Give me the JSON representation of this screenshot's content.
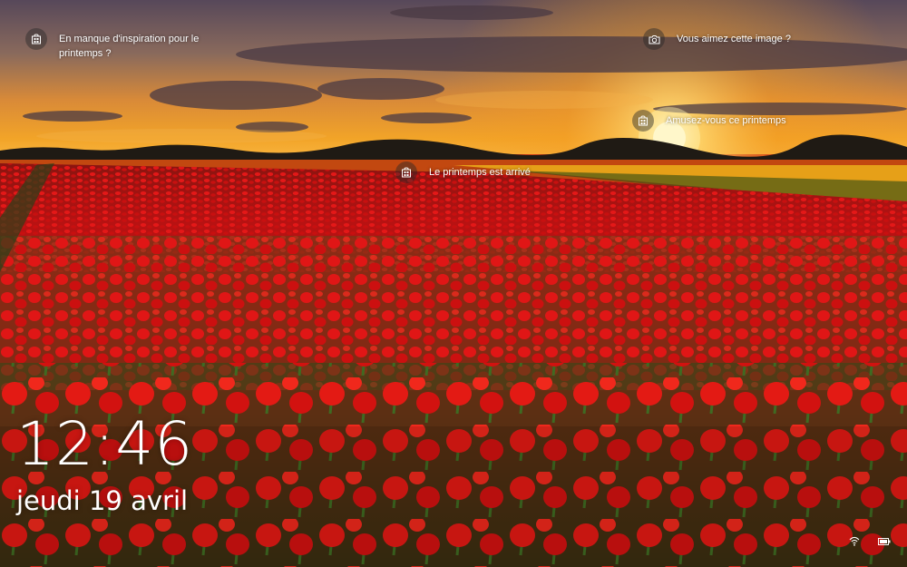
{
  "hotspots": [
    {
      "id": "inspiration",
      "icon": "store-icon",
      "text": "En manque d'inspiration pour le printemps ?"
    },
    {
      "id": "like_image",
      "icon": "camera-icon",
      "text": "Vous aimez cette image ?"
    },
    {
      "id": "spring_fun",
      "icon": "store-icon",
      "text": "Amusez-vous ce printemps"
    },
    {
      "id": "spring_arrived",
      "icon": "store-icon",
      "text": "Le printemps est arrivé"
    }
  ],
  "lockscreen": {
    "time": "12:46",
    "date": "jeudi 19 avril"
  },
  "tray": {
    "network_icon": "wifi-icon",
    "battery_icon": "battery-icon"
  },
  "colors": {
    "sky_top": "#5c4a58",
    "sky_glow": "#f3a020",
    "sun": "#fff4c0",
    "tulip_red": "#d81414",
    "field_dark": "#5a0a08",
    "leaf_green": "#2f5a20"
  }
}
